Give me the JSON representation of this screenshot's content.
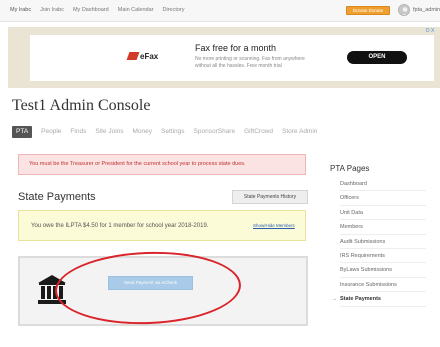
{
  "topnav": {
    "links": [
      "My Irabc",
      "Join Irabc",
      "My Dashboard",
      "Main Calendar",
      "Directory"
    ],
    "donate_label": "Donate Donate",
    "username": "fpta_admin"
  },
  "ad": {
    "logo": "eFax",
    "title": "Fax free for a month",
    "description": "No more printing or scanning. Fax from anywhere without all the hassles. Free month trial",
    "button": "OPEN",
    "badge": "D X"
  },
  "page_title": "Test1 Admin Console",
  "tabs": [
    "PTA",
    "People",
    "Finds",
    "Site Joins",
    "Money",
    "Settings",
    "SponsorShare",
    "GiftCrowd",
    "Store Admin"
  ],
  "alerts": {
    "error": "You must be the Treasurer or President for the current school year to process state dues.",
    "owe_message": "You owe the ILPTA $4.50 for 1 member for school year 2018-2019.",
    "owe_link": "Show/Hide Members"
  },
  "section": {
    "title": "State Payments",
    "history_button": "State Payments History",
    "pay_button": "Send Payment via eCheck"
  },
  "sidebar": {
    "title": "PTA Pages",
    "items": [
      {
        "label": "Dashboard"
      },
      {
        "label": "Officers"
      },
      {
        "label": "Unit Data"
      },
      {
        "label": "Members"
      },
      {
        "label": "Audit Submissions"
      },
      {
        "label": "IRS Requirements"
      },
      {
        "label": "ByLaws Submissions"
      },
      {
        "label": "Insurance Submissions"
      },
      {
        "label": "State Payments"
      }
    ]
  },
  "colors": {
    "accent_red": "#d9242b",
    "donate_orange": "#f0a030",
    "link_blue": "#2a5fae"
  }
}
